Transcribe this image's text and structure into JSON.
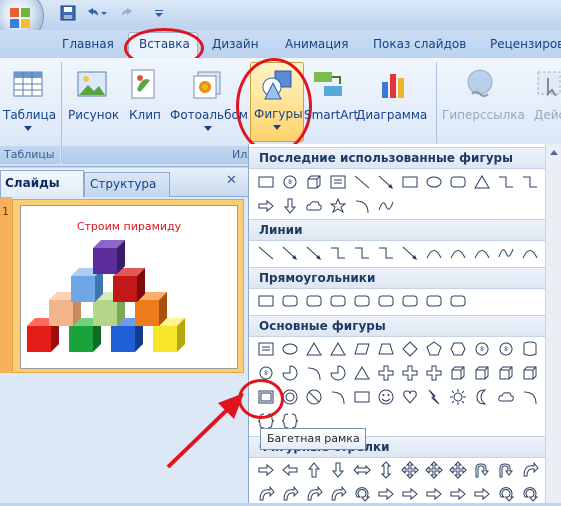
{
  "tabs": {
    "home": "Главная",
    "insert": "Вставка",
    "design": "Дизайн",
    "animation": "Анимация",
    "slideshow": "Показ слайдов",
    "review": "Рецензиров"
  },
  "ribbon": {
    "table": "Таблица",
    "picture": "Рисунок",
    "clip": "Клип",
    "photoalbum": "Фотоальбом",
    "shapes": "Фигуры",
    "smartart": "SmartArt",
    "chart": "Диаграмма",
    "hyperlink": "Гиперссылка",
    "action": "Действ",
    "group_tables": "Таблицы",
    "group_illustrations": "Иллюст"
  },
  "pane": {
    "tab_slides": "Слайды",
    "tab_structure": "Структура",
    "close": "✕",
    "slide_number": "1",
    "slide_title": "Строим пирамиду"
  },
  "gallery": {
    "recent": "Последние использованные фигуры",
    "lines": "Линии",
    "rectangles": "Прямоугольники",
    "basic": "Основные фигуры",
    "arrows_partial": "Фигурные стрелки"
  },
  "tooltip": "Багетная рамка",
  "colors": {
    "accent_red": "#e0141e",
    "ribbon_blue": "#15428b",
    "slide_title_red": "#e0141e"
  }
}
